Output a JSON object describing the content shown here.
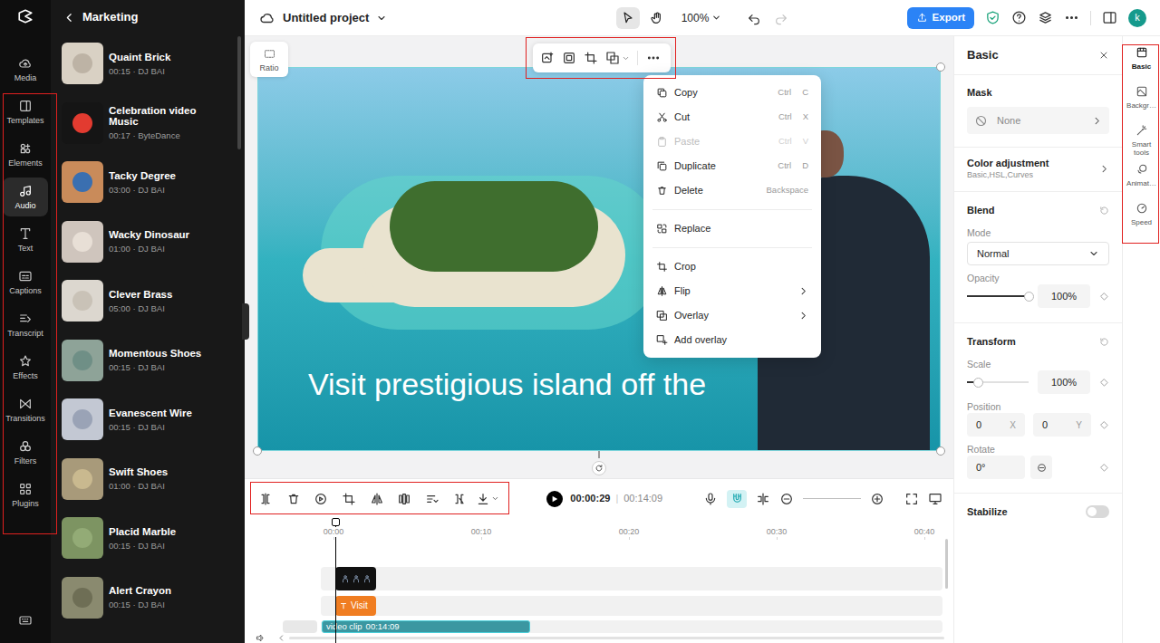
{
  "app": {
    "project_title": "Untitled project",
    "zoom": "100%",
    "export": "Export",
    "avatar": "k",
    "tools": [
      {
        "kind": "pointer",
        "selected": true
      },
      {
        "kind": "hand",
        "selected": false
      }
    ],
    "history": {
      "undo_disabled": false,
      "redo_disabled": true
    }
  },
  "nav": {
    "items": [
      {
        "label": "Media",
        "selected": false
      },
      {
        "label": "Templates",
        "selected": false
      },
      {
        "label": "Elements",
        "selected": false
      },
      {
        "label": "Audio",
        "selected": true
      },
      {
        "label": "Text",
        "selected": false
      },
      {
        "label": "Captions",
        "selected": false
      },
      {
        "label": "Transcript",
        "selected": false
      },
      {
        "label": "Effects",
        "selected": false
      },
      {
        "label": "Transitions",
        "selected": false
      },
      {
        "label": "Filters",
        "selected": false
      },
      {
        "label": "Plugins",
        "selected": false
      }
    ]
  },
  "audio_panel": {
    "title": "Marketing",
    "tracks": [
      {
        "title": "Quaint Brick",
        "meta": "00:15 · DJ BAI"
      },
      {
        "title": "Celebration video Music",
        "meta": "00:17 · ByteDance"
      },
      {
        "title": "Tacky Degree",
        "meta": "03:00 · DJ BAI"
      },
      {
        "title": "Wacky Dinosaur",
        "meta": "01:00 · DJ BAI"
      },
      {
        "title": "Clever Brass",
        "meta": "05:00 · DJ BAI"
      },
      {
        "title": "Momentous Shoes",
        "meta": "00:15 · DJ BAI"
      },
      {
        "title": "Evanescent Wire",
        "meta": "00:15 · DJ BAI"
      },
      {
        "title": "Swift Shoes",
        "meta": "01:00 · DJ BAI"
      },
      {
        "title": "Placid Marble",
        "meta": "00:15 · DJ BAI"
      },
      {
        "title": "Alert Crayon",
        "meta": "00:15 · DJ BAI"
      }
    ]
  },
  "canvas": {
    "ratio": "Ratio",
    "caption": "Visit prestigious island off the",
    "selected": true
  },
  "context_menu": {
    "groups": [
      [
        {
          "label": "Copy",
          "keys": [
            "Ctrl",
            "C"
          ],
          "disabled": false,
          "submenu": false
        },
        {
          "label": "Cut",
          "keys": [
            "Ctrl",
            "X"
          ],
          "disabled": false,
          "submenu": false
        },
        {
          "label": "Paste",
          "keys": [
            "Ctrl",
            "V"
          ],
          "disabled": true,
          "submenu": false
        },
        {
          "label": "Duplicate",
          "keys": [
            "Ctrl",
            "D"
          ],
          "disabled": false,
          "submenu": false
        },
        {
          "label": "Delete",
          "keys": [
            "Backspace"
          ],
          "disabled": false,
          "submenu": false
        }
      ],
      [
        {
          "label": "Replace",
          "keys": [],
          "disabled": false,
          "submenu": false
        }
      ],
      [
        {
          "label": "Crop",
          "keys": [],
          "disabled": false,
          "submenu": false
        },
        {
          "label": "Flip",
          "keys": [],
          "disabled": false,
          "submenu": true
        },
        {
          "label": "Overlay",
          "keys": [],
          "disabled": false,
          "submenu": true
        },
        {
          "label": "Add overlay",
          "keys": [],
          "disabled": false,
          "submenu": false
        }
      ]
    ]
  },
  "timeline": {
    "current": "00:00:29",
    "separator": "|",
    "total": "00:14:09",
    "snap_on": true,
    "ruler": [
      "00:00",
      "00:10",
      "00:20",
      "00:30",
      "00:40"
    ],
    "text_clip": "Visit",
    "video_clip": {
      "label": "video clip",
      "duration": "00:14:09"
    }
  },
  "properties": {
    "title": "Basic",
    "mask": {
      "label": "Mask",
      "value": "None"
    },
    "color_adjustment": {
      "label": "Color adjustment",
      "detail": "Basic,HSL,Curves"
    },
    "blend": {
      "label": "Blend",
      "mode_label": "Mode",
      "mode": "Normal",
      "opacity_label": "Opacity",
      "opacity": "100%",
      "opacity_level": 1
    },
    "transform": {
      "label": "Transform",
      "scale_label": "Scale",
      "scale": "100%",
      "scale_level": 0.19,
      "position_label": "Position",
      "x": "0",
      "x_axis": "X",
      "y": "0",
      "y_axis": "Y",
      "rotate_label": "Rotate",
      "rotate": "0°"
    },
    "stabilize": {
      "label": "Stabilize",
      "on": false
    }
  },
  "side_tabs": [
    {
      "label": "Basic",
      "selected": true
    },
    {
      "label": "Backgr…",
      "selected": false
    },
    {
      "label": "Smart tools",
      "selected": false
    },
    {
      "label": "Animat…",
      "selected": false
    },
    {
      "label": "Speed",
      "selected": false
    }
  ]
}
